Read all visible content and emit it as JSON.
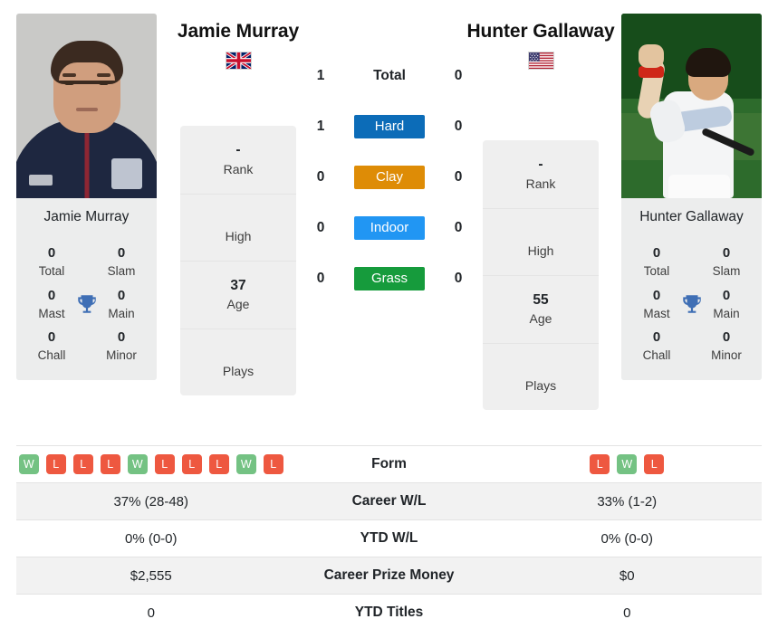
{
  "players": {
    "left": {
      "name": "Jamie Murray",
      "caption": "Jamie Murray",
      "flag": "uk-flag",
      "titles": [
        {
          "value": "0",
          "label": "Total"
        },
        {
          "value": "0",
          "label": "Slam"
        },
        {
          "value": "0",
          "label": "Mast"
        },
        {
          "value": "0",
          "label": "Main"
        },
        {
          "value": "0",
          "label": "Chall"
        },
        {
          "value": "0",
          "label": "Minor"
        }
      ],
      "info": [
        {
          "value": "-",
          "label": "Rank"
        },
        {
          "value": "",
          "label": "High"
        },
        {
          "value": "37",
          "label": "Age"
        },
        {
          "value": "",
          "label": "Plays"
        }
      ],
      "form": [
        "W",
        "L",
        "L",
        "L",
        "W",
        "L",
        "L",
        "L",
        "W",
        "L"
      ],
      "career_wl": "37% (28-48)",
      "ytd_wl": "0% (0-0)",
      "career_prize_money": "$2,555",
      "ytd_titles": "0"
    },
    "right": {
      "name": "Hunter Gallaway",
      "caption": "Hunter Gallaway",
      "flag": "us-flag",
      "titles": [
        {
          "value": "0",
          "label": "Total"
        },
        {
          "value": "0",
          "label": "Slam"
        },
        {
          "value": "0",
          "label": "Mast"
        },
        {
          "value": "0",
          "label": "Main"
        },
        {
          "value": "0",
          "label": "Chall"
        },
        {
          "value": "0",
          "label": "Minor"
        }
      ],
      "info": [
        {
          "value": "-",
          "label": "Rank"
        },
        {
          "value": "",
          "label": "High"
        },
        {
          "value": "55",
          "label": "Age"
        },
        {
          "value": "",
          "label": "Plays"
        }
      ],
      "form": [
        "L",
        "W",
        "L"
      ],
      "career_wl": "33% (1-2)",
      "ytd_wl": "0% (0-0)",
      "career_prize_money": "$0",
      "ytd_titles": "0"
    }
  },
  "surfaces": [
    {
      "label": "Total",
      "left": "1",
      "right": "0",
      "badge": false,
      "color": ""
    },
    {
      "label": "Hard",
      "left": "1",
      "right": "0",
      "badge": true,
      "color": "#0c6cb8"
    },
    {
      "label": "Clay",
      "left": "0",
      "right": "0",
      "badge": true,
      "color": "#de8c06"
    },
    {
      "label": "Indoor",
      "left": "0",
      "right": "0",
      "badge": true,
      "color": "#2196f3"
    },
    {
      "label": "Grass",
      "left": "0",
      "right": "0",
      "badge": true,
      "color": "#169b3c"
    }
  ],
  "table": {
    "rows": [
      {
        "label": "Form",
        "type": "form"
      },
      {
        "label": "Career W/L",
        "type": "text",
        "left_key": "career_wl",
        "right_key": "career_wl"
      },
      {
        "label": "YTD W/L",
        "type": "text",
        "left_key": "ytd_wl",
        "right_key": "ytd_wl"
      },
      {
        "label": "Career Prize Money",
        "type": "text",
        "left_key": "career_prize_money",
        "right_key": "career_prize_money"
      },
      {
        "label": "YTD Titles",
        "type": "text",
        "left_key": "ytd_titles",
        "right_key": "ytd_titles"
      }
    ]
  },
  "colors": {
    "win_badge": "#74c283",
    "loss_badge": "#ee5840",
    "trophy": "#3f6fb5",
    "card_bg": "#eceded",
    "row_shade": "#f2f2f2"
  }
}
